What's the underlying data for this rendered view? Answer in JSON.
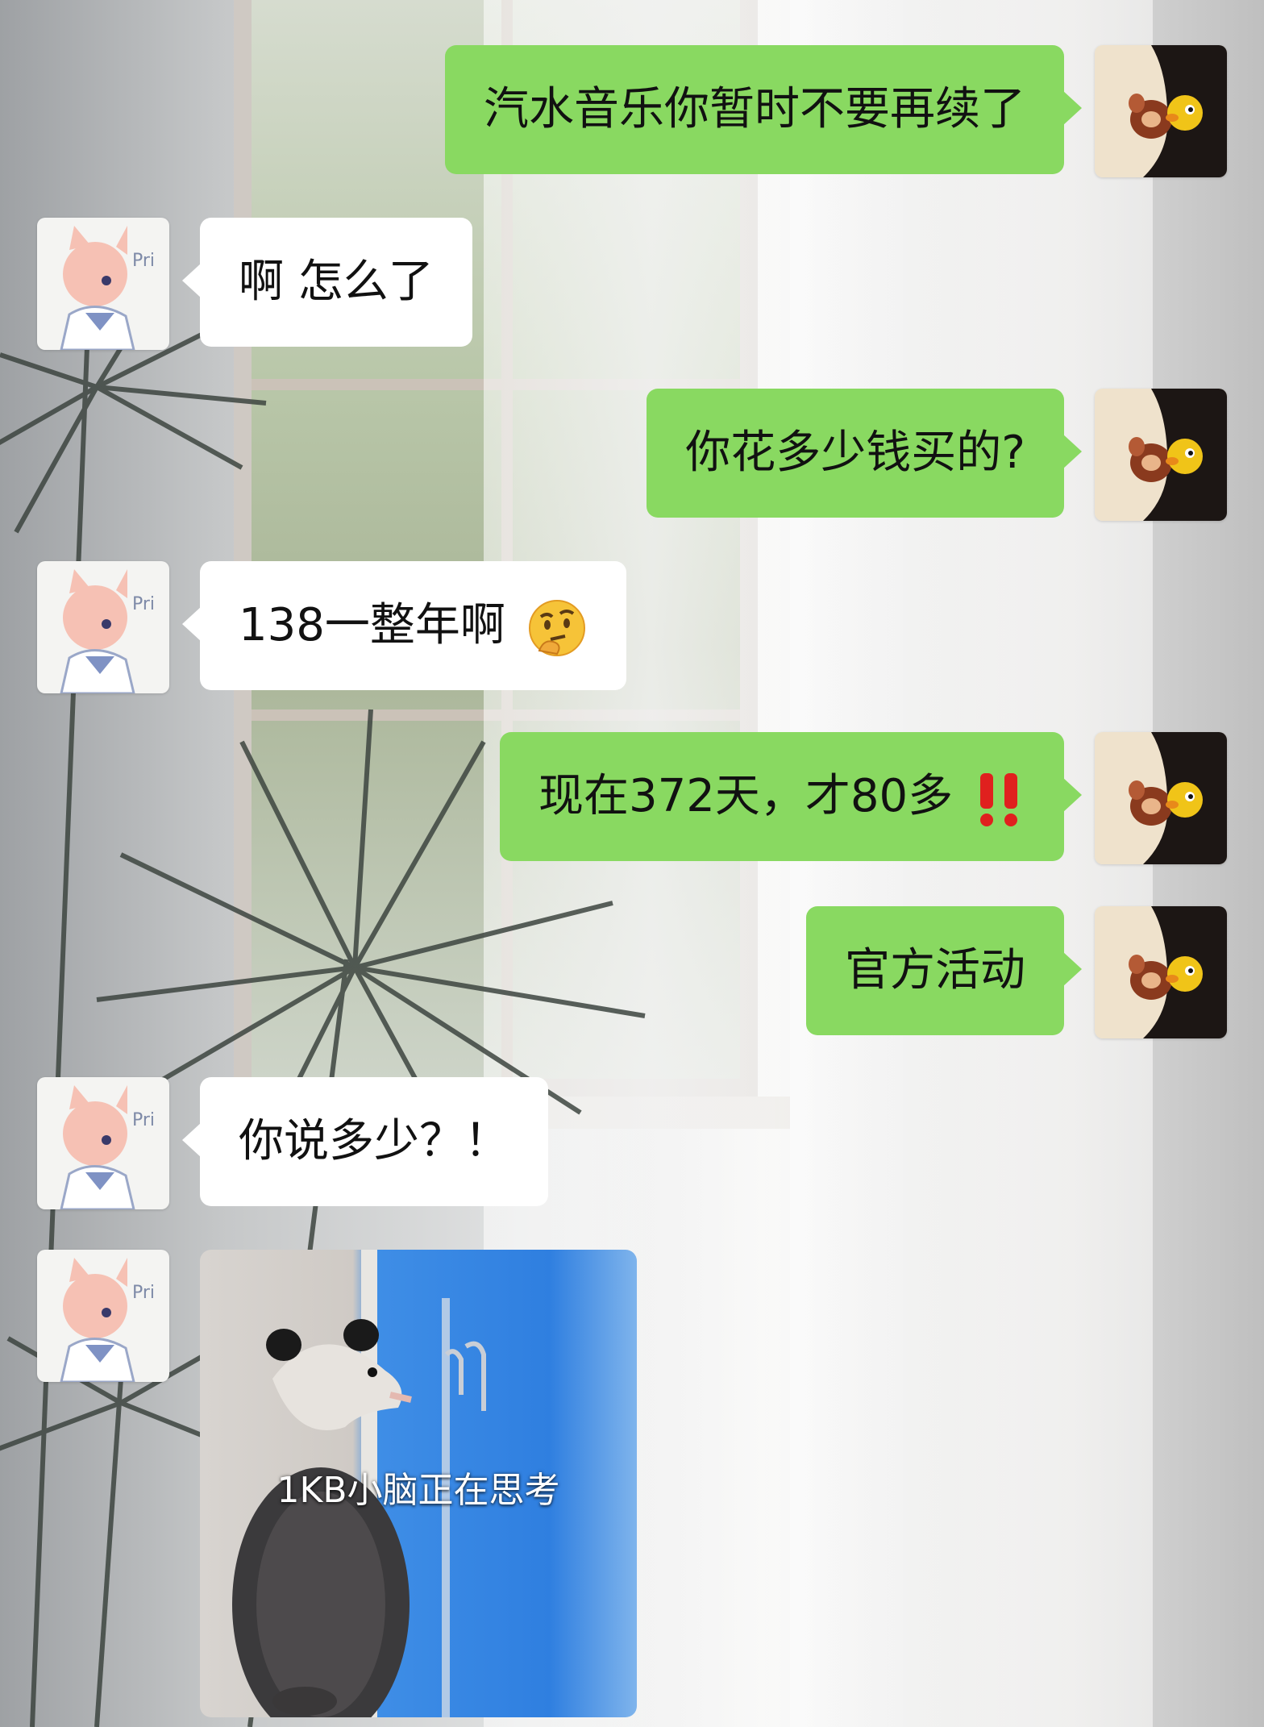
{
  "messages": [
    {
      "side": "me",
      "text": "汽水音乐你暂时不要再续了"
    },
    {
      "side": "them",
      "text": "啊 怎么了"
    },
    {
      "side": "me",
      "text": "你花多少钱买的?"
    },
    {
      "side": "them",
      "text": "138一整年啊",
      "emoji": "thinking-face-emoji"
    },
    {
      "side": "me",
      "text": "现在372天，才80多",
      "emoji": "double-exclamation-emoji"
    },
    {
      "side": "me",
      "text": "官方活动"
    },
    {
      "side": "them",
      "text": "你说多少？！"
    },
    {
      "side": "them",
      "type": "sticker",
      "caption": "1KB小脑正在思考"
    }
  ],
  "colors": {
    "me_bubble": "#89d961",
    "them_bubble": "#ffffff",
    "text": "#111111"
  },
  "avatars": {
    "me": "tom-and-jerry-avatar",
    "them": "pink-cartoon-kitten-avatar"
  }
}
